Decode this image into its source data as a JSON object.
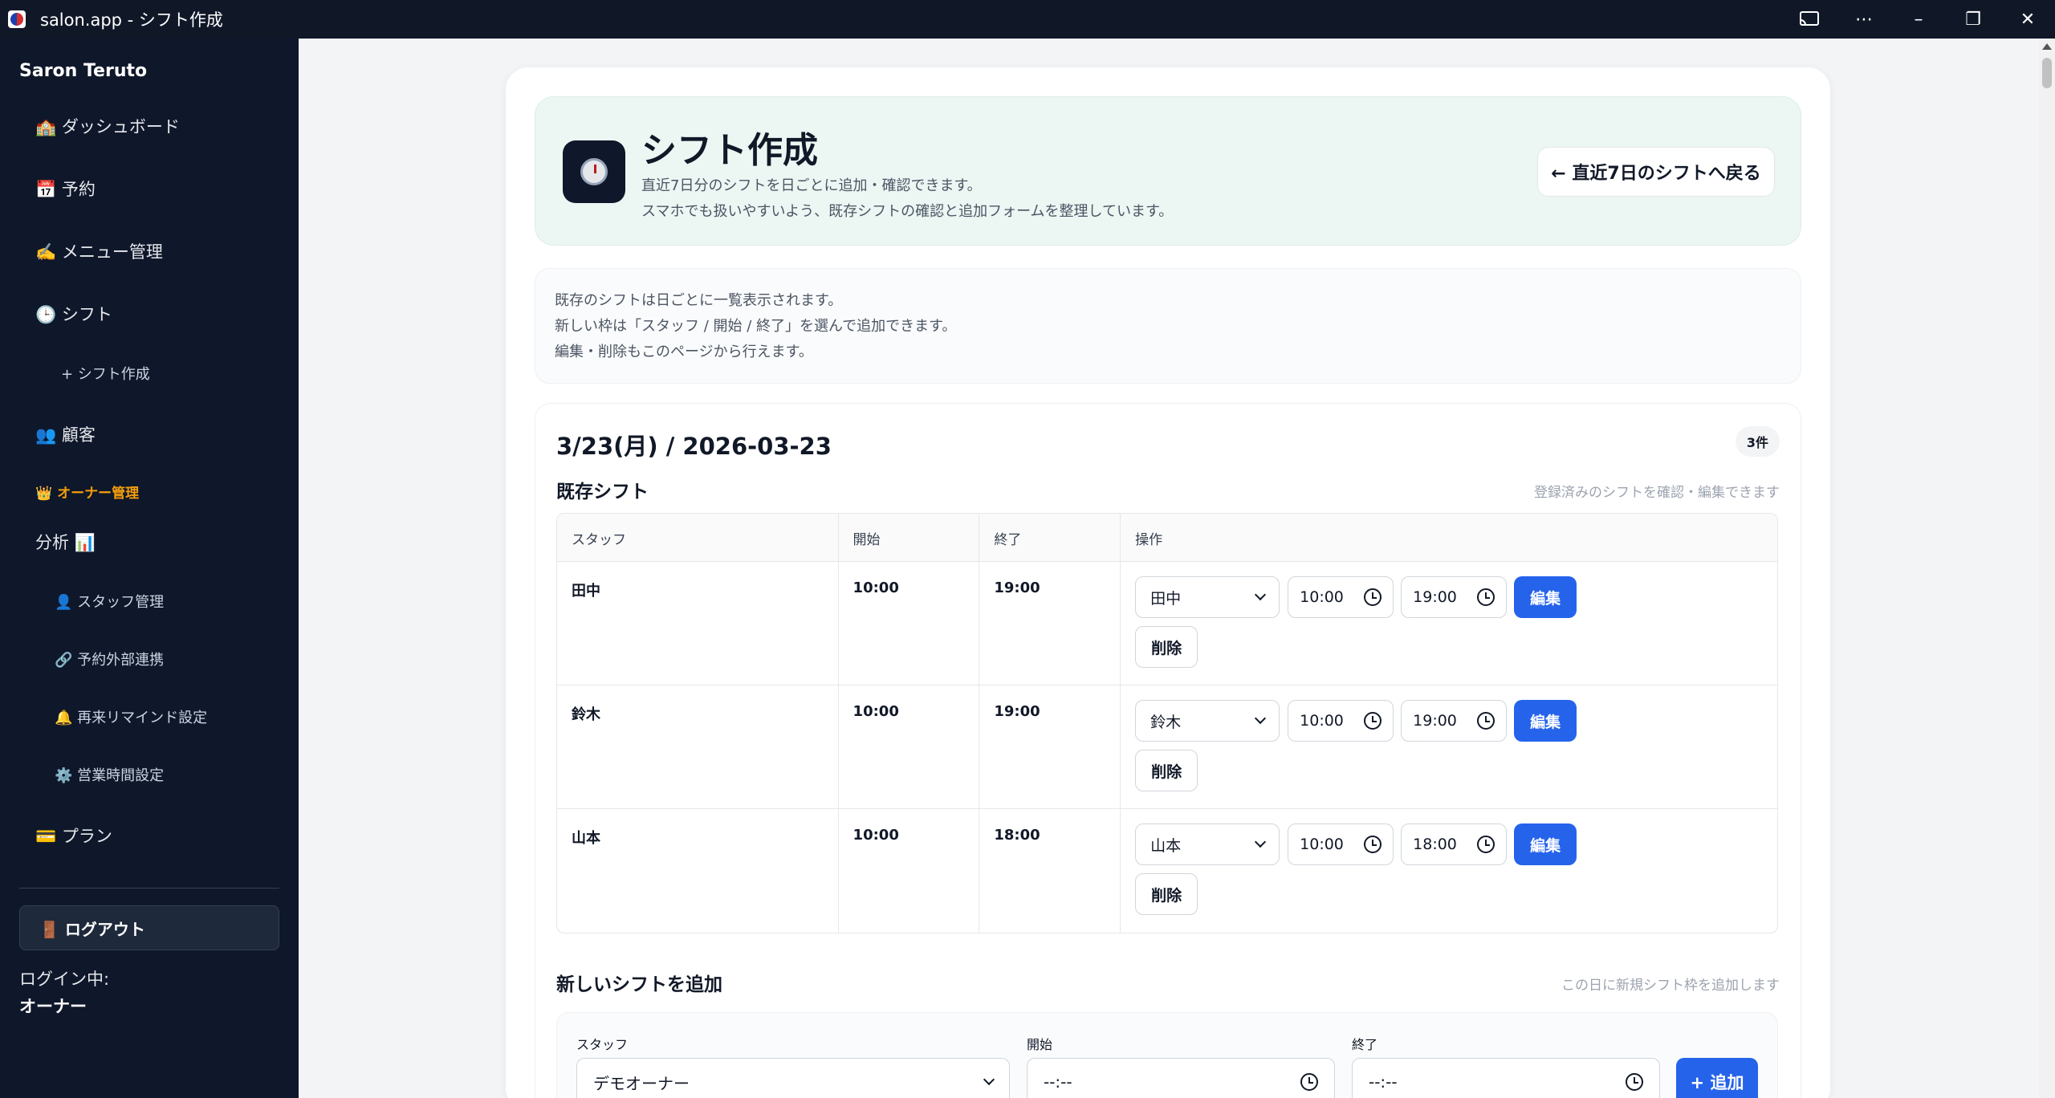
{
  "window": {
    "title": "salon.app - シフト作成",
    "controls": [
      "cast",
      "more",
      "minimize",
      "restore",
      "close"
    ]
  },
  "sidebar": {
    "brand": "Saron Teruto",
    "items": [
      {
        "label": "🏫 ダッシュボード"
      },
      {
        "label": "📅 予約"
      },
      {
        "label": "✍️ メニュー管理"
      },
      {
        "label": "🕒 シフト"
      }
    ],
    "shift_sub": "+ シフト作成",
    "customer": "👥 顧客",
    "owner_label": "👑 オーナー管理",
    "analytics": "分析 📊",
    "owner_items": [
      {
        "label": "👤 スタッフ管理"
      },
      {
        "label": "🔗 予約外部連携"
      },
      {
        "label": "🔔 再来リマインド設定"
      },
      {
        "label": "⚙️ 営業時間設定"
      }
    ],
    "plan": "💳 プラン",
    "logout": "🚪 ログアウト",
    "login_label": "ログイン中:",
    "login_user": "オーナー"
  },
  "hero": {
    "title": "シフト作成",
    "sub1": "直近7日分のシフトを日ごとに追加・確認できます。",
    "sub2": "スマホでも扱いやすいよう、既存シフトの確認と追加フォームを整理しています。",
    "back_button": "← 直近7日のシフトへ戻る"
  },
  "notes": [
    "既存のシフトは日ごとに一覧表示されます。",
    "新しい枠は「スタッフ / 開始 / 終了」を選んで追加できます。",
    "編集・削除もこのページから行えます。"
  ],
  "day": {
    "title": "3/23(月) / 2026-03-23",
    "count": "3件",
    "existing_title": "既存シフト",
    "existing_hint": "登録済みのシフトを確認・編集できます",
    "columns": [
      "スタッフ",
      "開始",
      "終了",
      "操作"
    ],
    "rows": [
      {
        "staff": "田中",
        "start": "10:00",
        "end": "19:00",
        "sel": "田中",
        "t_start": "10:00",
        "t_end": "19:00",
        "edit": "編集",
        "delete": "削除"
      },
      {
        "staff": "鈴木",
        "start": "10:00",
        "end": "19:00",
        "sel": "鈴木",
        "t_start": "10:00",
        "t_end": "19:00",
        "edit": "編集",
        "delete": "削除"
      },
      {
        "staff": "山本",
        "start": "10:00",
        "end": "18:00",
        "sel": "山本",
        "t_start": "10:00",
        "t_end": "18:00",
        "edit": "編集",
        "delete": "削除"
      }
    ],
    "add_title": "新しいシフトを追加",
    "add_hint": "この日に新規シフト枠を追加します",
    "add": {
      "staff_label": "スタッフ",
      "start_label": "開始",
      "end_label": "終了",
      "staff_value": "デモオーナー",
      "start_value": "--:--",
      "end_value": "--:--",
      "button": "+ 追加"
    }
  }
}
